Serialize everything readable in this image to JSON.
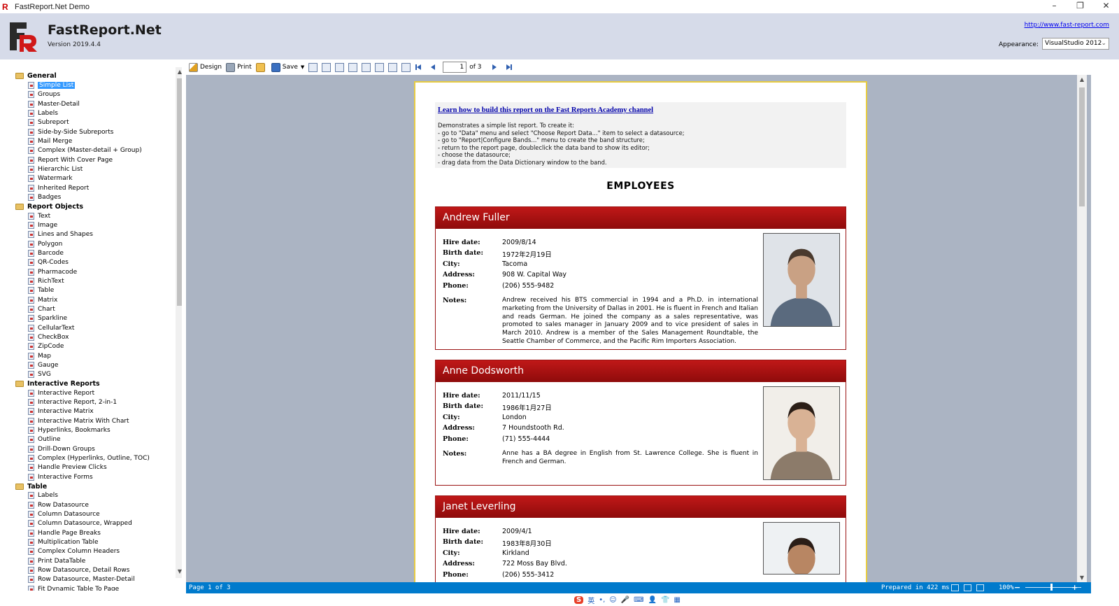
{
  "window": {
    "title": "FastReport.Net Demo",
    "minimize": "–",
    "restore": "❐",
    "close": "✕"
  },
  "header": {
    "brand": "FastReport.Net",
    "version": "Version 2019.4.4",
    "url": "http://www.fast-report.com",
    "appearance_label": "Appearance:",
    "appearance_value": "VisualStudio 2012"
  },
  "tree": [
    {
      "type": "folder",
      "label": "General"
    },
    {
      "type": "leaf",
      "label": "Simple List",
      "selected": true
    },
    {
      "type": "leaf",
      "label": "Groups"
    },
    {
      "type": "leaf",
      "label": "Master-Detail"
    },
    {
      "type": "leaf",
      "label": "Labels"
    },
    {
      "type": "leaf",
      "label": "Subreport"
    },
    {
      "type": "leaf",
      "label": "Side-by-Side Subreports"
    },
    {
      "type": "leaf",
      "label": "Mail Merge"
    },
    {
      "type": "leaf",
      "label": "Complex (Master-detail + Group)"
    },
    {
      "type": "leaf",
      "label": "Report With Cover Page"
    },
    {
      "type": "leaf",
      "label": "Hierarchic List"
    },
    {
      "type": "leaf",
      "label": "Watermark"
    },
    {
      "type": "leaf",
      "label": "Inherited Report"
    },
    {
      "type": "leaf",
      "label": "Badges"
    },
    {
      "type": "folder",
      "label": "Report Objects"
    },
    {
      "type": "leaf",
      "label": "Text"
    },
    {
      "type": "leaf",
      "label": "Image"
    },
    {
      "type": "leaf",
      "label": "Lines and Shapes"
    },
    {
      "type": "leaf",
      "label": "Polygon"
    },
    {
      "type": "leaf",
      "label": "Barcode"
    },
    {
      "type": "leaf",
      "label": "QR-Codes"
    },
    {
      "type": "leaf",
      "label": "Pharmacode"
    },
    {
      "type": "leaf",
      "label": "RichText"
    },
    {
      "type": "leaf",
      "label": "Table"
    },
    {
      "type": "leaf",
      "label": "Matrix"
    },
    {
      "type": "leaf",
      "label": "Chart"
    },
    {
      "type": "leaf",
      "label": "Sparkline"
    },
    {
      "type": "leaf",
      "label": "CellularText"
    },
    {
      "type": "leaf",
      "label": "CheckBox"
    },
    {
      "type": "leaf",
      "label": "ZipCode"
    },
    {
      "type": "leaf",
      "label": "Map"
    },
    {
      "type": "leaf",
      "label": "Gauge"
    },
    {
      "type": "leaf",
      "label": "SVG"
    },
    {
      "type": "folder",
      "label": "Interactive Reports"
    },
    {
      "type": "leaf",
      "label": "Interactive Report"
    },
    {
      "type": "leaf",
      "label": "Interactive Report, 2-in-1"
    },
    {
      "type": "leaf",
      "label": "Interactive Matrix"
    },
    {
      "type": "leaf",
      "label": "Interactive Matrix With Chart"
    },
    {
      "type": "leaf",
      "label": "Hyperlinks, Bookmarks"
    },
    {
      "type": "leaf",
      "label": "Outline"
    },
    {
      "type": "leaf",
      "label": "Drill-Down Groups"
    },
    {
      "type": "leaf",
      "label": "Complex (Hyperlinks, Outline, TOC)"
    },
    {
      "type": "leaf",
      "label": "Handle Preview Clicks"
    },
    {
      "type": "leaf",
      "label": "Interactive Forms"
    },
    {
      "type": "folder",
      "label": "Table"
    },
    {
      "type": "leaf",
      "label": "Labels"
    },
    {
      "type": "leaf",
      "label": "Row Datasource"
    },
    {
      "type": "leaf",
      "label": "Column Datasource"
    },
    {
      "type": "leaf",
      "label": "Column Datasource, Wrapped"
    },
    {
      "type": "leaf",
      "label": "Handle Page Breaks"
    },
    {
      "type": "leaf",
      "label": "Multiplication Table"
    },
    {
      "type": "leaf",
      "label": "Complex Column Headers"
    },
    {
      "type": "leaf",
      "label": "Print DataTable"
    },
    {
      "type": "leaf",
      "label": "Row Datasource, Detail Rows"
    },
    {
      "type": "leaf",
      "label": "Row Datasource, Master-Detail"
    },
    {
      "type": "leaf",
      "label": "Fit Dynamic Table To Page"
    }
  ],
  "toolbar": {
    "design": "Design",
    "print": "Print",
    "save": "Save",
    "page_current": "1",
    "page_of": "of 3"
  },
  "report": {
    "academy_link": "Learn how to build this report on the Fast Reports Academy channel",
    "instructions": [
      "Demonstrates a simple list report. To create it:",
      "- go to \"Data\" menu and select \"Choose Report Data...\" item to select a datasource;",
      "- go to \"Report|Configure Bands...\" menu to create the band structure;",
      "- return to the report page, doubleclick the data band to show its editor;",
      "- choose the datasource;",
      "- drag data from the Data Dictionary window to the band."
    ],
    "title": "EMPLOYEES",
    "labels": {
      "hire": "Hire date:",
      "birth": "Birth date:",
      "city": "City:",
      "address": "Address:",
      "phone": "Phone:",
      "notes": "Notes:"
    },
    "employees": [
      {
        "name": "Andrew Fuller",
        "hire": "2009/8/14",
        "birth": "1972年2月19日",
        "city": "Tacoma",
        "address": "908 W. Capital Way",
        "phone": "(206) 555-9482",
        "notes": "Andrew received his BTS commercial in 1994 and a Ph.D. in international marketing from the University of Dallas in 2001. He is fluent in French and Italian and reads German. He joined the company as a sales representative, was promoted to sales manager in January 2009 and to vice president of sales in March 2010. Andrew is a member of the Sales Management Roundtable, the Seattle Chamber of Commerce, and the Pacific Rim Importers Association."
      },
      {
        "name": "Anne Dodsworth",
        "hire": "2011/11/15",
        "birth": "1986年1月27日",
        "city": "London",
        "address": "7 Houndstooth Rd.",
        "phone": "(71) 555-4444",
        "notes": "Anne has a BA degree in English from St. Lawrence College. She is fluent in French and German."
      },
      {
        "name": "Janet Leverling",
        "hire": "2009/4/1",
        "birth": "1983年8月30日",
        "city": "Kirkland",
        "address": "722 Moss Bay Blvd.",
        "phone": "(206) 555-3412",
        "notes": ""
      }
    ]
  },
  "status": {
    "page": "Page 1 of 3",
    "prepared": "Prepared in 422 ms",
    "zoom": "100%",
    "minus": "−",
    "plus": "+"
  },
  "ime": {
    "logo": "S",
    "lang": "英",
    "items": [
      "•,",
      "☺",
      "🎤",
      "⌨",
      "👤",
      "👕",
      "▦"
    ]
  },
  "colors": {
    "header_bg": "#d6dbe9",
    "status_bg": "#007acc",
    "band_red": "#a80f0f",
    "preview_bg": "#abb4c3",
    "selection": "#3399ff"
  }
}
